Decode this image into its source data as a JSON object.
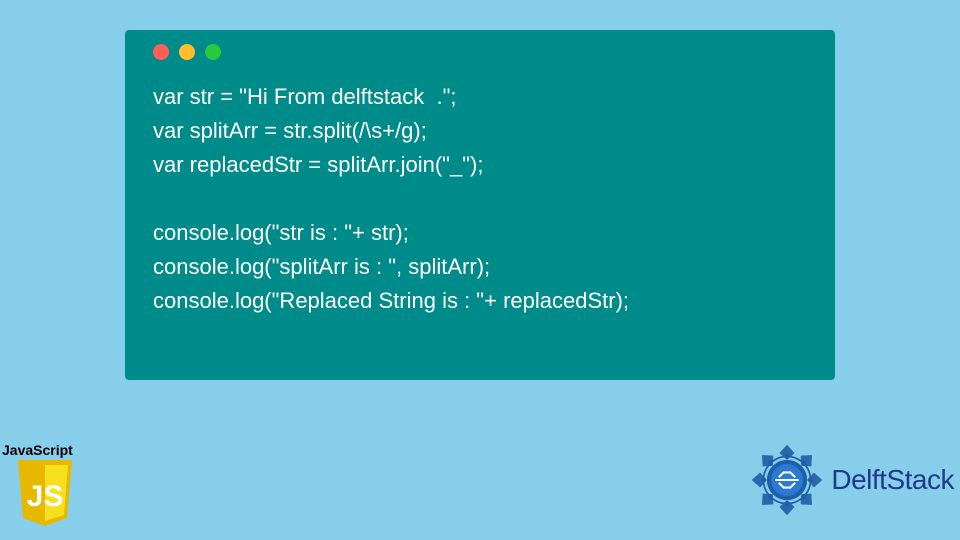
{
  "code": {
    "lines": [
      "var str = \"Hi From delftstack  .\";",
      "var splitArr = str.split(/\\s+/g);",
      "var replacedStr = splitArr.join(\"_\");",
      "",
      "console.log(\"str is : \"+ str);",
      "console.log(\"splitArr is : \", splitArr);",
      "console.log(\"Replaced String is : \"+ replacedStr);"
    ]
  },
  "js_logo": {
    "label": "JavaScript",
    "shield_text": "JS"
  },
  "delft_logo": {
    "text": "DelftStack"
  },
  "colors": {
    "background": "#87CEEB",
    "code_bg": "#008B8B",
    "code_text": "#FFFFFF",
    "js_yellow": "#F7DF1E",
    "delft_blue": "#1E3A8A"
  }
}
